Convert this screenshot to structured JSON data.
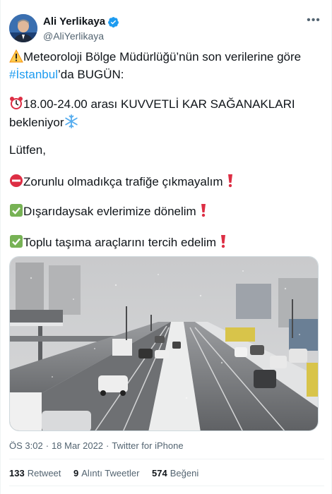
{
  "author": {
    "display_name": "Ali Yerlikaya",
    "handle": "@AliYerlikaya",
    "verified": true
  },
  "tweet": {
    "line1_text": "Meteoroloji Bölge Müdürlüğü’nün son verilerine göre",
    "line2_hashtag": "#İstanbul",
    "line2_text": "’da BUGÜN:",
    "line3_text": "18.00-24.00 arası KUVVETLİ KAR SAĞANAKLARI",
    "line4_text": "bekleniyor",
    "line5_text": "Lütfen,",
    "line6_text": "Zorunlu olmadıkça trafiğe çıkmayalım",
    "line7_text": "Dışarıdaysak evlerimize dönelim",
    "line8_text": "Toplu taşıma araçlarını tercih edelim",
    "emojis": [
      "warning-icon",
      "alarm-clock-icon",
      "snowflake-icon",
      "no-entry-icon",
      "check-mark-button-icon",
      "exclamation-icon"
    ]
  },
  "meta": {
    "time": "ÖS 3:02",
    "separator": "·",
    "date": "18 Mar 2022",
    "source": "Twitter for iPhone"
  },
  "stats": {
    "retweets_count": "133",
    "retweets_label": "Retweet",
    "quotes_count": "9",
    "quotes_label": "Alıntı Tweetler",
    "likes_count": "574",
    "likes_label": "Beğeni"
  },
  "colors": {
    "link": "#1d9bf0",
    "text": "#0f1419",
    "secondary": "#536471",
    "verified": "#1d9bf0",
    "red_mark": "#e0245e",
    "green_check": "#77b255"
  }
}
